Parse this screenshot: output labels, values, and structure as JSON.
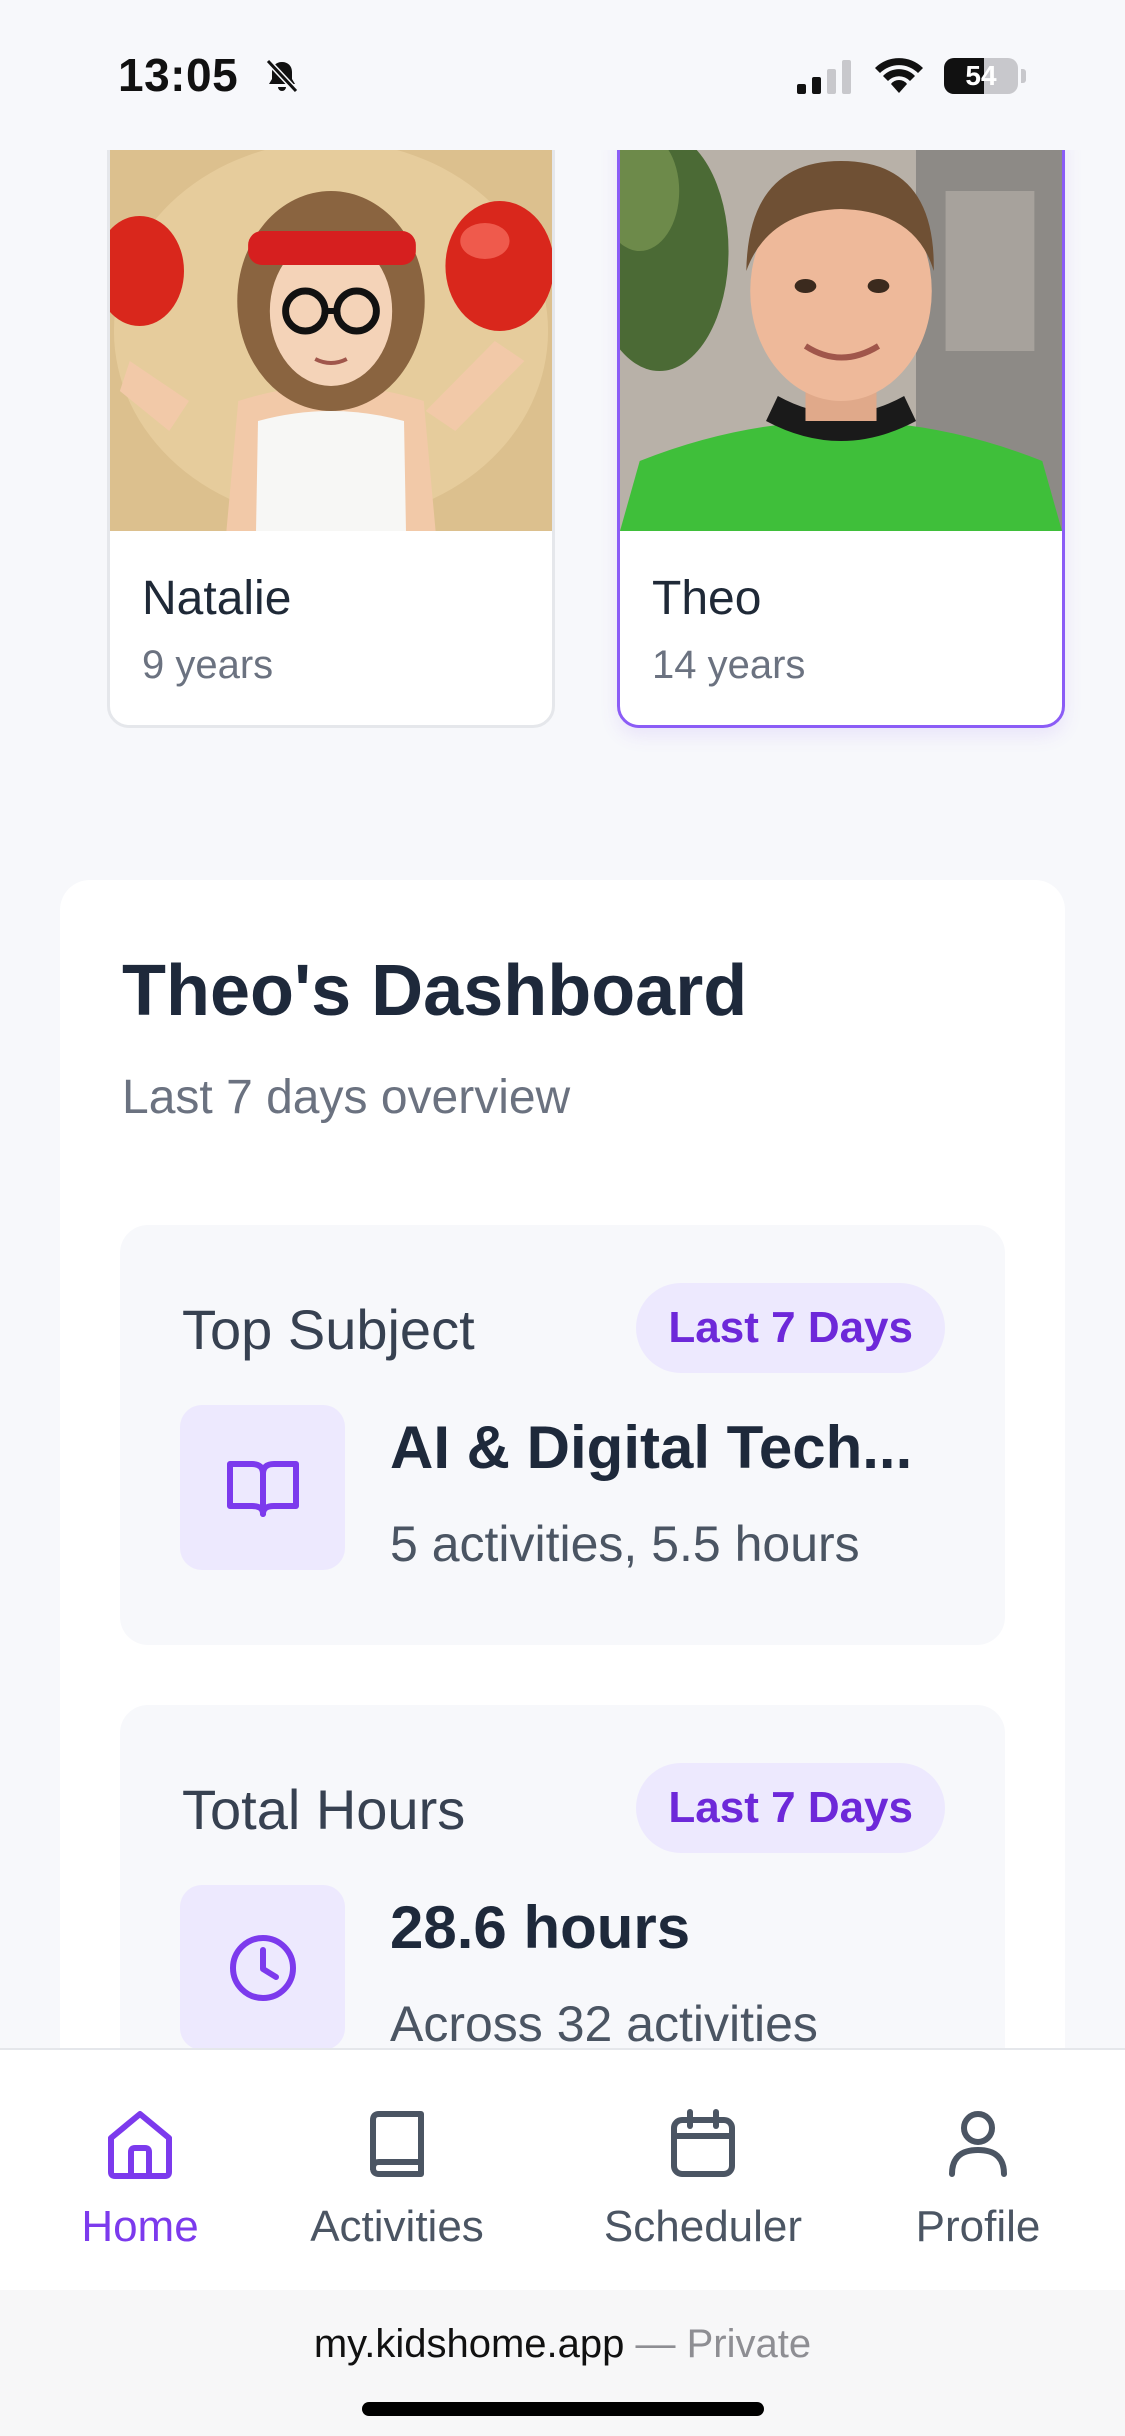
{
  "status_bar": {
    "time": "13:05",
    "battery": "54",
    "battery_level": 0.54
  },
  "children": [
    {
      "name": "Natalie",
      "age": "9 years",
      "selected": false
    },
    {
      "name": "Theo",
      "age": "14 years",
      "selected": true
    }
  ],
  "dashboard": {
    "title": "Theo's Dashboard",
    "subtitle": "Last 7 days overview",
    "cards": [
      {
        "label": "Top Subject",
        "badge": "Last 7 Days",
        "icon": "book-open-icon",
        "value": "AI & Digital Tech...",
        "detail": "5 activities, 5.5 hours"
      },
      {
        "label": "Total Hours",
        "badge": "Last 7 Days",
        "icon": "clock-icon",
        "value": "28.6 hours",
        "detail": "Across 32 activities"
      }
    ]
  },
  "nav": [
    {
      "label": "Home",
      "icon": "home-icon",
      "active": true
    },
    {
      "label": "Activities",
      "icon": "book-icon",
      "active": false
    },
    {
      "label": "Scheduler",
      "icon": "calendar-icon",
      "active": false
    },
    {
      "label": "Profile",
      "icon": "user-icon",
      "active": false
    }
  ],
  "browser": {
    "domain": "my.kidshome.app",
    "separator": "—",
    "mode": "Private"
  },
  "colors": {
    "accent": "#7c3aed",
    "badge_bg": "#ede9fe",
    "text_dark": "#1e293b",
    "text_muted": "#6b7280"
  }
}
